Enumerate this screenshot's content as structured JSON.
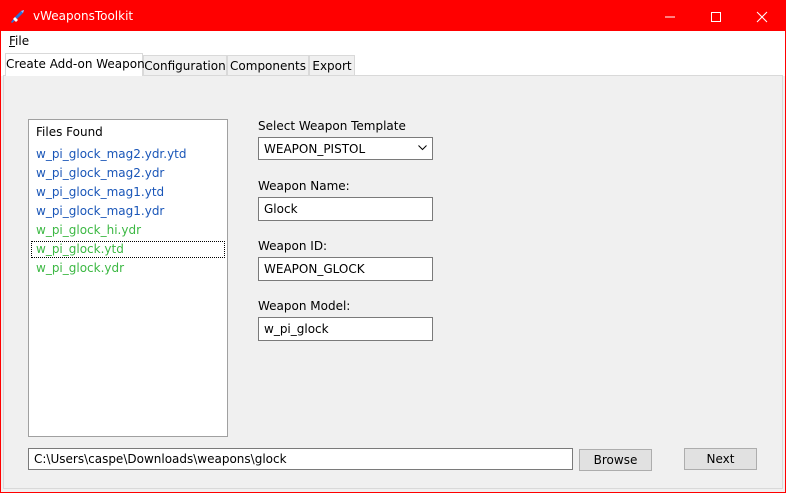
{
  "window": {
    "title": "vWeaponsToolkit",
    "accent": "#ff0000"
  },
  "menu": {
    "items": [
      {
        "label": "File",
        "accelerator": "F"
      }
    ]
  },
  "tabs": [
    {
      "label": "Create Add-on Weapon",
      "active": true
    },
    {
      "label": "Configuration",
      "active": false
    },
    {
      "label": "Components",
      "active": false
    },
    {
      "label": "Export",
      "active": false
    }
  ],
  "files": {
    "header": "Files Found",
    "items": [
      {
        "name": "w_pi_glock_mag2.ydr.ytd",
        "color": "#1a56b8"
      },
      {
        "name": "w_pi_glock_mag2.ydr",
        "color": "#1a56b8"
      },
      {
        "name": "w_pi_glock_mag1.ytd",
        "color": "#1a56b8"
      },
      {
        "name": "w_pi_glock_mag1.ydr",
        "color": "#1a56b8"
      },
      {
        "name": "w_pi_glock_hi.ydr",
        "color": "#3cb843"
      },
      {
        "name": "w_pi_glock.ytd",
        "color": "#3cb843",
        "focused": true
      },
      {
        "name": "w_pi_glock.ydr",
        "color": "#3cb843"
      }
    ]
  },
  "form": {
    "template_label": "Select Weapon Template",
    "template_value": "WEAPON_PISTOL",
    "name_label": "Weapon Name:",
    "name_value": "Glock",
    "id_label": "Weapon ID:",
    "id_value": "WEAPON_GLOCK",
    "model_label": "Weapon Model:",
    "model_value": "w_pi_glock"
  },
  "footer": {
    "path_value": "C:\\Users\\caspe\\Downloads\\weapons\\glock",
    "browse_label": "Browse",
    "next_label": "Next"
  }
}
